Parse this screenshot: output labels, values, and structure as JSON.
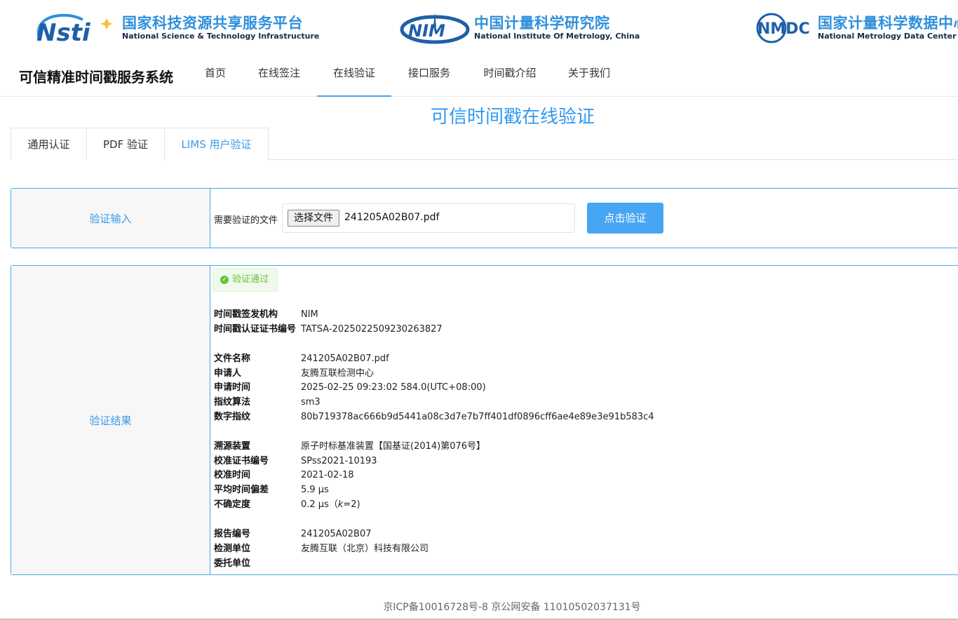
{
  "header": {
    "logo1": {
      "cn": "国家科技资源共享服务平台",
      "en": "National Science & Technology Infrastructure"
    },
    "logo2": {
      "cn": "中国计量科学研究院",
      "en": "National Institute Of Metrology, China"
    },
    "logo3": {
      "cn": "国家计量科学数据中心",
      "en": "National Metrology Data Center"
    }
  },
  "nav": {
    "brand": "可信精准时间戳服务系统",
    "items": [
      {
        "label": "首页"
      },
      {
        "label": "在线签注"
      },
      {
        "label": "在线验证"
      },
      {
        "label": "接口服务"
      },
      {
        "label": "时间戳介绍"
      },
      {
        "label": "关于我们"
      }
    ],
    "active_index": 2
  },
  "page": {
    "title": "可信时间戳在线验证"
  },
  "tabs": [
    {
      "label": "通用认证"
    },
    {
      "label": "PDF 验证"
    },
    {
      "label": "LIMS 用户验证"
    }
  ],
  "input_panel": {
    "label": "验证输入",
    "file_label": "需要验证的文件",
    "choose_file": "选择文件",
    "file_name": "241205A02B07.pdf",
    "verify_button": "点击验证"
  },
  "result_panel": {
    "label": "验证结果",
    "badge": "验证通过",
    "issuer_key": "时间戳签发机构",
    "issuer_val": "NIM",
    "cert_key": "时间戳认证证书编号",
    "cert_val": "TATSA-2025022509230263827",
    "filename_key": "文件名称",
    "filename_val": "241205A02B07.pdf",
    "applicant_key": "申请人",
    "applicant_val": "友腾互联检测中心",
    "apply_time_key": "申请时间",
    "apply_time_val": "2025-02-25 09:23:02 584.0(UTC+08:00)",
    "algo_key": "指纹算法",
    "algo_val": "sm3",
    "digest_key": "数字指纹",
    "digest_val": "80b719378ac666b9d5441a08c3d7e7b7ff401df0896cff6ae4e89e3e91b583c4",
    "source_key": "溯源装置",
    "source_val": "原子时标基准装置【国基证(2014)第076号】",
    "calib_cert_key": "校准证书编号",
    "calib_cert_val": "SPss2021-10193",
    "calib_time_key": "校准时间",
    "calib_time_val": "2021-02-18",
    "offset_key": "平均时间偏差",
    "offset_val": "5.9 μs",
    "uncert_key": "不确定度",
    "uncert_val_a": "0.2 μs（",
    "uncert_val_k": "k",
    "uncert_val_b": "=2)",
    "report_key": "报告编号",
    "report_val": "241205A02B07",
    "lab_key": "检测单位",
    "lab_val": "友腾互联（北京）科技有限公司",
    "client_key": "委托单位",
    "client_val": ""
  },
  "footer": {
    "text": "京ICP备10016728号-8 京公网安备 11010502037131号"
  },
  "colors": {
    "accent": "#3a9ae8",
    "button": "#46a6f3",
    "success": "#67c23a",
    "border": "#46a8e8"
  }
}
